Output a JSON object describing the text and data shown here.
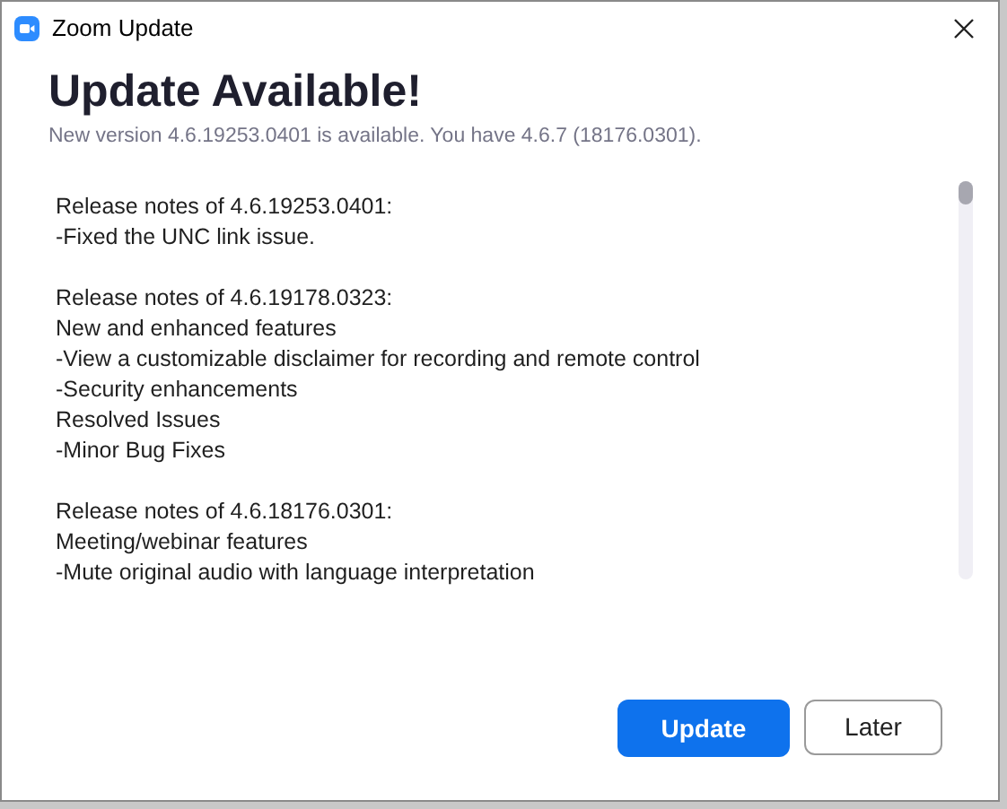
{
  "window": {
    "title": "Zoom Update"
  },
  "heading": "Update Available!",
  "subtitle": "New version 4.6.19253.0401 is available. You have 4.6.7 (18176.0301).",
  "release_notes": [
    {
      "lines": [
        "Release notes of 4.6.19253.0401:",
        "-Fixed the UNC link issue."
      ]
    },
    {
      "lines": [
        "Release notes of 4.6.19178.0323:",
        "New and enhanced features",
        "-View a customizable disclaimer for recording and remote control",
        "-Security enhancements",
        "Resolved Issues",
        "-Minor Bug Fixes"
      ]
    },
    {
      "lines": [
        "Release notes of 4.6.18176.0301:",
        "Meeting/webinar features",
        "-Mute original audio with language interpretation"
      ]
    }
  ],
  "buttons": [
    {
      "label": "Update",
      "kind": "primary"
    },
    {
      "label": "Later",
      "kind": "secondary"
    }
  ]
}
